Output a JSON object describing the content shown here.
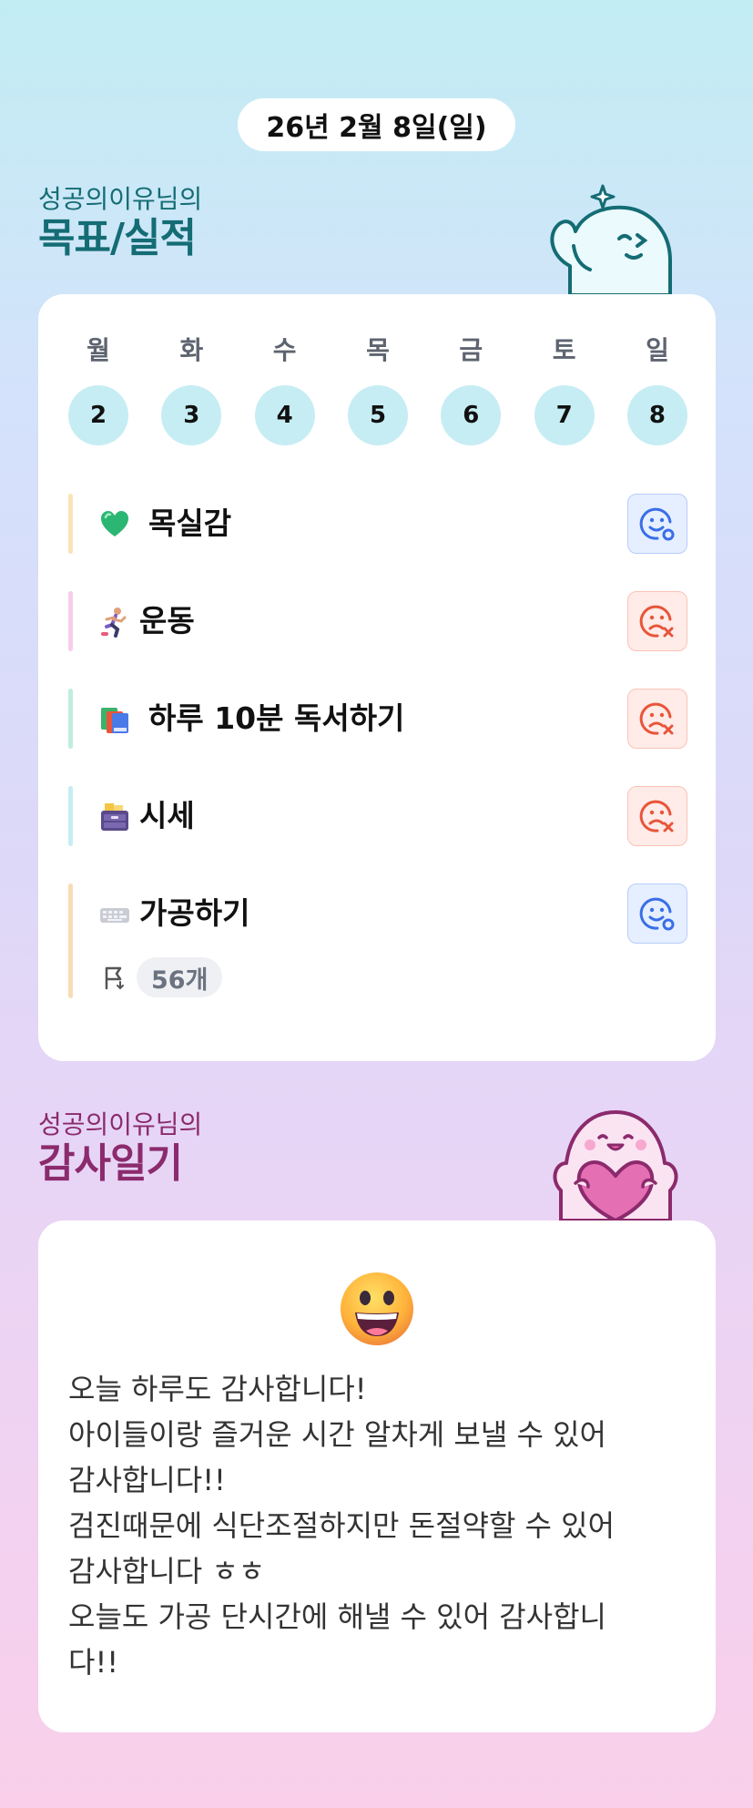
{
  "date": "26년 2월 8일(일)",
  "goals_section": {
    "subtitle": "성공의이유님의",
    "title": "목표/실적",
    "week": [
      {
        "day": "월",
        "date": "2"
      },
      {
        "day": "화",
        "date": "3"
      },
      {
        "day": "수",
        "date": "4"
      },
      {
        "day": "목",
        "date": "5"
      },
      {
        "day": "금",
        "date": "6"
      },
      {
        "day": "토",
        "date": "7"
      },
      {
        "day": "일",
        "date": "8"
      }
    ],
    "goals": [
      {
        "label": "목실감",
        "icon": "green-heart-icon",
        "accent": "#fbe3b5",
        "status": "done"
      },
      {
        "label": "운동",
        "icon": "runner-icon",
        "accent": "#f8cde8",
        "status": "failed"
      },
      {
        "label": "하루 10분 독서하기",
        "icon": "books-icon",
        "accent": "#bfeedd",
        "status": "failed"
      },
      {
        "label": "시세",
        "icon": "file-cabinet-icon",
        "accent": "#c6edf3",
        "status": "failed"
      },
      {
        "label": "가공하기",
        "icon": "keyboard-icon",
        "accent": "#f9dcb5",
        "status": "done",
        "count": "56개"
      }
    ]
  },
  "thanks_section": {
    "subtitle": "성공의이유님의",
    "title": "감사일기",
    "mood_icon": "grinning-face-icon",
    "text": "오늘 하루도 감사합니다!\n아이들이랑 즐거운 시간 알차게 보낼 수 있어\n감사합니다!!\n검진때문에 식단조절하지만 돈절약할 수 있어\n감사합니다 ㅎㅎ\n오늘도 가공 단시간에 해낼 수 있어 감사합니\n다!!"
  },
  "colors": {
    "goal_title": "#146c74",
    "thanks_title": "#8b2a6c",
    "done_status": "#3a6ee8",
    "failed_status": "#e8553a",
    "day_circle": "#c6edf3"
  }
}
